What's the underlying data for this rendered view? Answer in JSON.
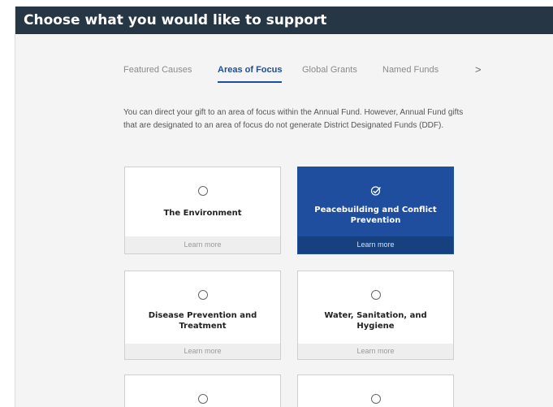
{
  "header": {
    "title": "Choose what you would like to support"
  },
  "tabs": [
    {
      "label": "Featured Causes",
      "active": false
    },
    {
      "label": "Areas of Focus",
      "active": true
    },
    {
      "label": "Global Grants",
      "active": false
    },
    {
      "label": "Named Funds",
      "active": false
    }
  ],
  "tabs_next_label": ">",
  "intro_text": "You can direct your gift to an area of focus within the Annual Fund. However, Annual Fund gifts that are designated to an area of focus do not generate District Designated Funds (DDF).",
  "cards": [
    {
      "title": "The Environment",
      "footer": "Learn more",
      "selected": false
    },
    {
      "title": "Peacebuilding and Conflict Prevention",
      "footer": "Learn more",
      "selected": true
    },
    {
      "title": "Disease Prevention and Treatment",
      "footer": "Learn more",
      "selected": false
    },
    {
      "title": "Water, Sanitation, and Hygiene",
      "footer": "Learn more",
      "selected": false
    },
    {
      "title": "",
      "footer": "",
      "selected": false
    },
    {
      "title": "",
      "footer": "",
      "selected": false
    }
  ],
  "colors": {
    "header_bg": "#263644",
    "accent": "#1f4e9f",
    "active_tab": "#1f4d9a"
  },
  "icons": {
    "unselected": "radio-empty-icon",
    "selected": "check-circle-icon",
    "tab_next": "chevron-right-icon"
  }
}
